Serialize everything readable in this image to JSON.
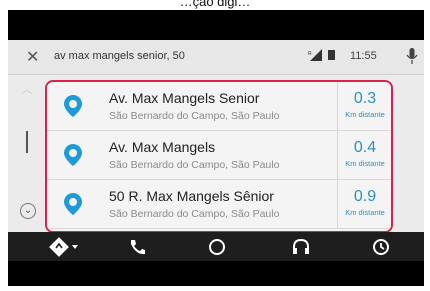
{
  "top_caption": "…ção digi…",
  "search": {
    "query": "av max mangels senior, 50",
    "close_icon": "close-icon",
    "mic_icon": "mic-icon"
  },
  "status": {
    "time": "11:55",
    "signal_icon": "signal-icon",
    "battery_icon": "battery-icon"
  },
  "results": [
    {
      "name": "Av. Max Mangels Senior",
      "address": "São Bernardo do Campo, São Paulo",
      "distance": "0.3",
      "unit": "Km distante",
      "icon": "location-pin-icon"
    },
    {
      "name": "Av. Max Mangels",
      "address": "São Bernardo do Campo, São Paulo",
      "distance": "0.4",
      "unit": "Km distante",
      "icon": "location-pin-icon"
    },
    {
      "name": "50 R. Max Mangels Sênior",
      "address": "São Bernardo do Campo, São Paulo",
      "distance": "0.9",
      "unit": "Km distante",
      "icon": "location-pin-icon"
    }
  ],
  "bottom_nav": [
    "navigation-icon",
    "phone-icon",
    "home-icon",
    "headphones-icon",
    "recent-icon"
  ],
  "colors": {
    "highlight": "#d6244a",
    "accent": "#2b8fc3",
    "pin": "#1e9ad6"
  }
}
